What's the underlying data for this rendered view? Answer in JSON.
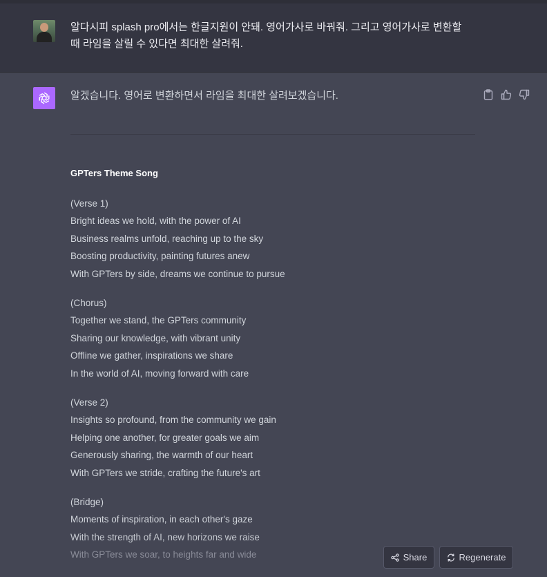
{
  "user_message": {
    "text_line1": "알다시피 splash pro에서는 한글지원이 안돼. 영어가사로 바꿔줘. 그리고 영어가사로 변환할",
    "text_line2": "때 라임을 살릴 수 있다면 최대한 살려줘."
  },
  "assistant": {
    "intro": "알겠습니다. 영어로 변환하면서 라임을 최대한 살려보겠습니다.",
    "song_title": "GPTers Theme Song",
    "sections": [
      {
        "label": "(Verse 1)",
        "lines": [
          "Bright ideas we hold, with the power of AI",
          "Business realms unfold, reaching up to the sky",
          "Boosting productivity, painting futures anew",
          "With GPTers by side, dreams we continue to pursue"
        ]
      },
      {
        "label": "(Chorus)",
        "lines": [
          "Together we stand, the GPTers community",
          "Sharing our knowledge, with vibrant unity",
          "Offline we gather, inspirations we share",
          "In the world of AI, moving forward with care"
        ]
      },
      {
        "label": "(Verse 2)",
        "lines": [
          "Insights so profound, from the community we gain",
          "Helping one another, for greater goals we aim",
          "Generously sharing, the warmth of our heart",
          "With GPTers we stride, crafting the future's art"
        ]
      },
      {
        "label": "(Bridge)",
        "lines": [
          "Moments of inspiration, in each other's gaze",
          "With the strength of AI, new horizons we raise",
          "With GPTers we soar, to heights far and wide"
        ]
      }
    ]
  },
  "controls": {
    "share_label": "Share",
    "regenerate_label": "Regenerate"
  },
  "icons": [
    "clipboard-icon",
    "thumbs-up-icon",
    "thumbs-down-icon",
    "share-icon",
    "regenerate-icon",
    "openai-logo-icon"
  ],
  "colors": {
    "background": "#444654",
    "user_bg": "#343541",
    "gpt_avatar": "#ab68ff"
  }
}
